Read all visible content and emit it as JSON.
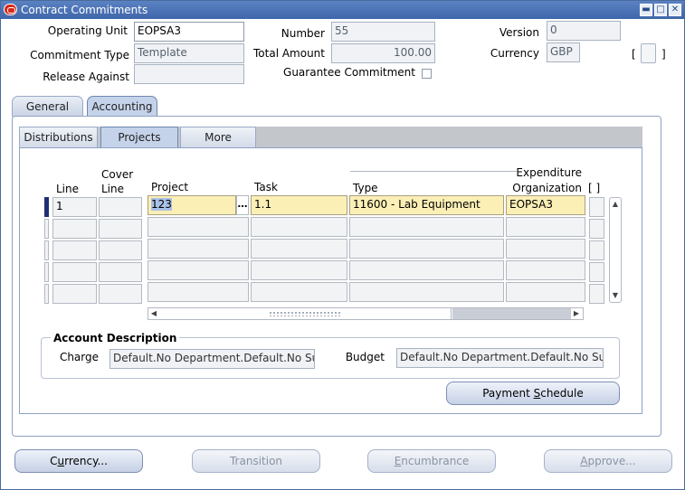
{
  "window": {
    "title": "Contract Commitments",
    "buttons": {
      "minimize": "▬",
      "maximize": "□",
      "close": "✕"
    }
  },
  "header": {
    "operating_unit": {
      "label": "Operating Unit",
      "value": "EOPSA3"
    },
    "number": {
      "label": "Number",
      "value": "55"
    },
    "version": {
      "label": "Version",
      "value": "0"
    },
    "commitment_type": {
      "label": "Commitment Type",
      "value": "Template"
    },
    "total_amount": {
      "label": "Total Amount",
      "value": "100.00"
    },
    "currency": {
      "label": "Currency",
      "value": "GBP"
    },
    "release_against": {
      "label": "Release Against",
      "value": ""
    },
    "guarantee": {
      "label": "Guarantee Commitment",
      "checked": false
    },
    "bracket_open": "[",
    "bracket_close": "]"
  },
  "tabs": [
    {
      "label": "General",
      "active": false
    },
    {
      "label": "Accounting",
      "active": true
    }
  ],
  "subtabs": [
    {
      "label": "Distributions",
      "active": false
    },
    {
      "label": "Projects",
      "active": true
    },
    {
      "label": "More",
      "active": false
    }
  ],
  "grid": {
    "headers": {
      "line": "Line",
      "cover_line": "Cover Line",
      "project": "Project",
      "task": "Task",
      "type": "Type",
      "expenditure_org": "Expenditure Organization",
      "bracket": "[ ]"
    },
    "rows": [
      {
        "line": "1",
        "cover_line": "",
        "project": "123",
        "task": "1.1",
        "type": "11600 - Lab Equipment",
        "expenditure_org": "EOPSA3"
      },
      {
        "line": "",
        "cover_line": "",
        "project": "",
        "task": "",
        "type": "",
        "expenditure_org": ""
      },
      {
        "line": "",
        "cover_line": "",
        "project": "",
        "task": "",
        "type": "",
        "expenditure_org": ""
      },
      {
        "line": "",
        "cover_line": "",
        "project": "",
        "task": "",
        "type": "",
        "expenditure_org": ""
      },
      {
        "line": "",
        "cover_line": "",
        "project": "",
        "task": "",
        "type": "",
        "expenditure_org": ""
      }
    ],
    "lov_symbol": "…"
  },
  "account_description": {
    "title": "Account Description",
    "charge": {
      "label": "Charge",
      "value": "Default.No Department.Default.No Sub"
    },
    "budget": {
      "label": "Budget",
      "value": "Default.No Department.Default.No Sub"
    }
  },
  "buttons": {
    "payment_schedule": {
      "pre": "Payment ",
      "accel": "S",
      "post": "chedule"
    },
    "currency": {
      "pre": "C",
      "accel": "u",
      "post": "rrency..."
    },
    "transition": {
      "pre": "",
      "accel": "",
      "post": "Transition"
    },
    "encumbrance": {
      "pre": "",
      "accel": "E",
      "post": "ncumbrance"
    },
    "approve": {
      "pre": "",
      "accel": "A",
      "post": "pprove..."
    }
  },
  "icons": {
    "scroll_up": "▲",
    "scroll_down": "▼",
    "scroll_left": "◀",
    "scroll_right": "▶"
  }
}
